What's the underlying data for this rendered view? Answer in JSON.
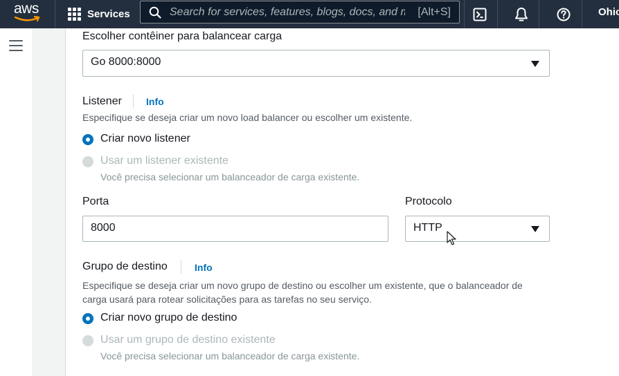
{
  "topnav": {
    "logo_text": "aws",
    "services_label": "Services",
    "search_placeholder": "Search for services, features, blogs, docs, and more",
    "search_shortcut": "[Alt+S]",
    "region": "Ohio"
  },
  "colors": {
    "nav_bg": "#232f3e",
    "accent": "#0073bb",
    "logo_smile": "#ff9900"
  },
  "form": {
    "container_select": {
      "label": "Escolher contêiner para balancear carga",
      "value": "Go 8000:8000"
    },
    "listener": {
      "title": "Listener",
      "info": "Info",
      "description": "Especifique se deseja criar um novo load balancer ou escolher um existente.",
      "option_new": "Criar novo listener",
      "option_existing": "Usar um listener existente",
      "option_existing_hint": "Você precisa selecionar um balanceador de carga existente."
    },
    "port": {
      "label": "Porta",
      "value": "8000"
    },
    "protocol": {
      "label": "Protocolo",
      "value": "HTTP"
    },
    "target_group": {
      "title": "Grupo de destino",
      "info": "Info",
      "description_line1": "Especifique se deseja criar um novo grupo de destino ou escolher um existente, que o balanceador de",
      "description_line2": "carga usará para rotear solicitações para as tarefas no seu serviço.",
      "option_new": "Criar novo grupo de destino",
      "option_existing": "Usar um grupo de destino existente",
      "option_existing_hint": "Você precisa selecionar um balanceador de carga existente."
    }
  }
}
